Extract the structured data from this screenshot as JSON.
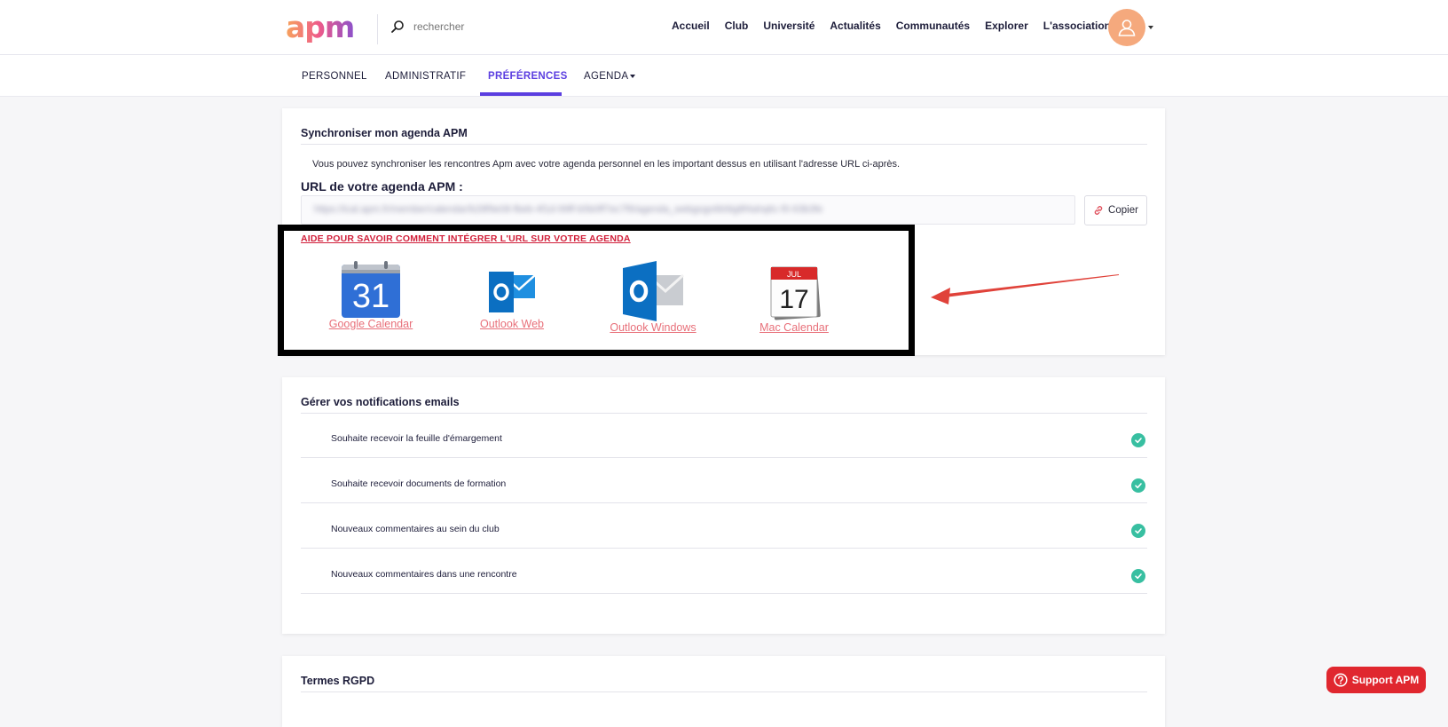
{
  "header": {
    "logo_text": "apm",
    "search_placeholder": "rechercher",
    "nav": [
      "Accueil",
      "Club",
      "Université",
      "Actualités",
      "Communautés",
      "Explorer",
      "L'association"
    ]
  },
  "tabs": [
    {
      "label": "PERSONNEL",
      "active": false
    },
    {
      "label": "ADMINISTRATIF",
      "active": false
    },
    {
      "label": "PRÉFÉRENCES",
      "active": true
    },
    {
      "label": "AGENDA",
      "active": false,
      "dropdown": true
    }
  ],
  "sync": {
    "title": "Synchroniser mon agenda APM",
    "description": "Vous pouvez synchroniser les rencontres Apm avec votre agenda personnel en les important dessus en utilisant l'adresse URL ci-après.",
    "url_label": "URL de votre agenda APM :",
    "url_value": "https://ical.apm.fr/member/calendar/b28f9e08-fbeb-4f1d-99ff-b5b0ff7ec7f9/agenda_webgogo6b9ig8f4ahq6c-f0-63b3fe",
    "copy_label": "Copier",
    "help_link": "AIDE POUR SAVOIR COMMENT INTÉGRER L'URL SUR VOTRE AGENDA",
    "calendars": [
      {
        "label": "Google Calendar",
        "icon": "google-calendar-icon",
        "day": "31"
      },
      {
        "label": "Outlook Web",
        "icon": "outlook-web-icon"
      },
      {
        "label": "Outlook Windows",
        "icon": "outlook-windows-icon"
      },
      {
        "label": "Mac Calendar",
        "icon": "mac-calendar-icon",
        "month": "JUL",
        "day": "17"
      }
    ]
  },
  "notifications": {
    "title": "Gérer vos notifications emails",
    "items": [
      {
        "label": "Souhaite recevoir la feuille d'émargement",
        "checked": true
      },
      {
        "label": "Souhaite recevoir documents de formation",
        "checked": true
      },
      {
        "label": "Nouveaux commentaires au sein du club",
        "checked": true
      },
      {
        "label": "Nouveaux commentaires dans une rencontre",
        "checked": true
      }
    ]
  },
  "rgpd": {
    "title": "Termes RGPD"
  },
  "support": {
    "label": "Support APM"
  },
  "colors": {
    "accent": "#5b3ee0",
    "check": "#38bfa1",
    "support": "#e0272f",
    "link": "#e8707a"
  }
}
